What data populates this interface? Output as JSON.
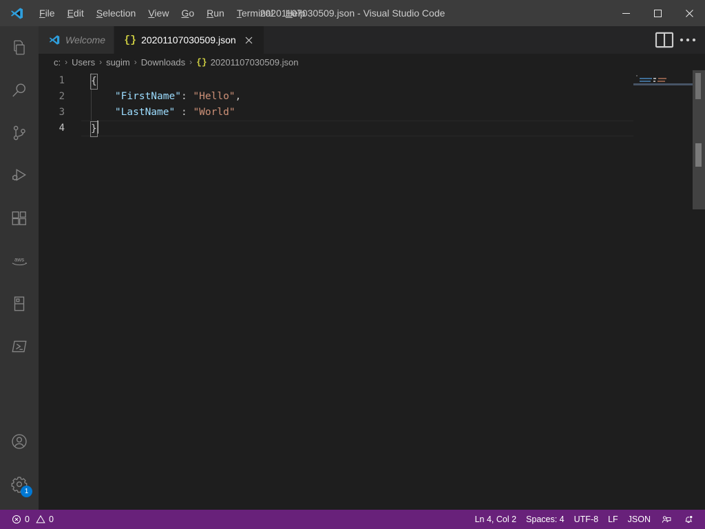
{
  "window": {
    "title": "20201107030509.json - Visual Studio Code",
    "minimize_label": "Minimize",
    "maximize_label": "Maximize",
    "close_label": "Close"
  },
  "menu": {
    "items": [
      {
        "label": "File",
        "mnemonic": "F",
        "rest": "ile"
      },
      {
        "label": "Edit",
        "mnemonic": "E",
        "rest": "dit"
      },
      {
        "label": "Selection",
        "mnemonic": "S",
        "rest": "election"
      },
      {
        "label": "View",
        "mnemonic": "V",
        "rest": "iew"
      },
      {
        "label": "Go",
        "mnemonic": "G",
        "rest": "o"
      },
      {
        "label": "Run",
        "mnemonic": "R",
        "rest": "un"
      },
      {
        "label": "Terminal",
        "mnemonic": "T",
        "rest": "erminal"
      },
      {
        "label": "Help",
        "mnemonic": "H",
        "rest": "elp"
      }
    ]
  },
  "activitybar": {
    "top": [
      {
        "name": "explorer",
        "title": "Explorer"
      },
      {
        "name": "search",
        "title": "Search"
      },
      {
        "name": "source-control",
        "title": "Source Control"
      },
      {
        "name": "run-and-debug",
        "title": "Run and Debug"
      },
      {
        "name": "extensions",
        "title": "Extensions"
      },
      {
        "name": "aws",
        "title": "AWS",
        "text": "aws"
      },
      {
        "name": "database",
        "title": "Database"
      },
      {
        "name": "terminal-powershell",
        "title": "PowerShell"
      }
    ],
    "bottom": [
      {
        "name": "accounts",
        "title": "Accounts"
      },
      {
        "name": "manage-settings",
        "title": "Manage",
        "badge": "1"
      }
    ]
  },
  "tabs": [
    {
      "label": "Welcome",
      "icon": "vscode-logo",
      "active": false,
      "italic": true,
      "closable": false
    },
    {
      "label": "20201107030509.json",
      "icon": "json",
      "active": true,
      "italic": false,
      "closable": true
    }
  ],
  "tab_actions": {
    "split_editor": "Split Editor",
    "more_actions": "More Actions..."
  },
  "breadcrumb": {
    "items": [
      "c:",
      "Users",
      "sugim",
      "Downloads"
    ],
    "file": "20201107030509.json",
    "file_icon": "{}",
    "separator": "›"
  },
  "editor": {
    "lines": [
      {
        "number": "1",
        "active": false,
        "tokens": [
          {
            "type": "brace-match",
            "text": "{"
          }
        ]
      },
      {
        "number": "2",
        "active": false,
        "tokens": [
          {
            "type": "plain",
            "text": "    "
          },
          {
            "type": "key",
            "text": "\"FirstName\""
          },
          {
            "type": "punct",
            "text": ":"
          },
          {
            "type": "plain",
            "text": " "
          },
          {
            "type": "string",
            "text": "\"Hello\""
          },
          {
            "type": "punct",
            "text": ","
          }
        ]
      },
      {
        "number": "3",
        "active": false,
        "tokens": [
          {
            "type": "plain",
            "text": "    "
          },
          {
            "type": "key",
            "text": "\"LastName\""
          },
          {
            "type": "plain",
            "text": " "
          },
          {
            "type": "punct",
            "text": ":"
          },
          {
            "type": "plain",
            "text": " "
          },
          {
            "type": "string",
            "text": "\"World\""
          }
        ]
      },
      {
        "number": "4",
        "active": true,
        "tokens": [
          {
            "type": "brace-match",
            "text": "}"
          },
          {
            "type": "cursor",
            "text": ""
          }
        ]
      }
    ],
    "raw_text": "{\n    \"FirstName\": \"Hello\",\n    \"LastName\" : \"World\"\n}",
    "language": "JSON"
  },
  "statusbar": {
    "left": [
      {
        "name": "problems",
        "icon": "error-circle",
        "text": "0",
        "second_icon": "warning-triangle",
        "second_text": "0"
      }
    ],
    "errors": "0",
    "warnings": "0",
    "right": [
      {
        "name": "editor-position",
        "text": "Ln 4, Col 2"
      },
      {
        "name": "editor-indentation",
        "text": "Spaces: 4"
      },
      {
        "name": "editor-encoding",
        "text": "UTF-8"
      },
      {
        "name": "editor-eol",
        "text": "LF"
      },
      {
        "name": "editor-language",
        "text": "JSON"
      }
    ],
    "feedback_title": "Tweet Feedback",
    "notifications_title": "No Notifications"
  },
  "colors": {
    "titlebar_bg": "#3c3c3c",
    "activitybar_bg": "#333333",
    "editor_bg": "#1e1e1e",
    "tabbar_bg": "#252526",
    "tab_inactive_bg": "#2d2d2d",
    "statusbar_bg": "#68217a",
    "accent_blue": "#0078d4",
    "json_icon": "#cbcb41",
    "key_color": "#9cdcfe",
    "string_color": "#ce9178",
    "linenumber_color": "#858585"
  }
}
